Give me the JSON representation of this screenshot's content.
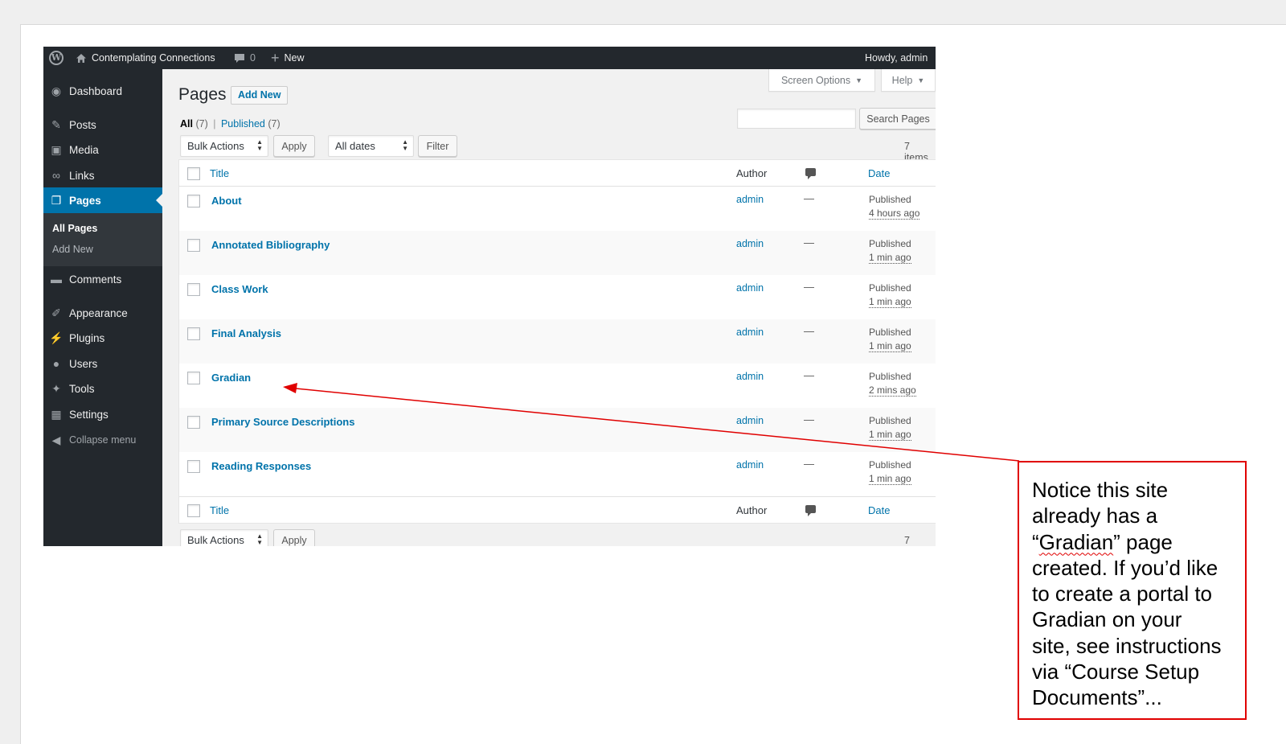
{
  "admin_bar": {
    "site_name": "Contemplating Connections",
    "comments_count": "0",
    "new_label": "New",
    "howdy": "Howdy, admin"
  },
  "sidebar": {
    "items": [
      {
        "label": "Dashboard",
        "icon": "dashboard-icon"
      },
      {
        "label": "Posts",
        "icon": "pin-icon"
      },
      {
        "label": "Media",
        "icon": "media-icon"
      },
      {
        "label": "Links",
        "icon": "link-icon"
      },
      {
        "label": "Pages",
        "icon": "pages-icon"
      },
      {
        "label": "Comments",
        "icon": "comment-icon"
      },
      {
        "label": "Appearance",
        "icon": "brush-icon"
      },
      {
        "label": "Plugins",
        "icon": "plug-icon"
      },
      {
        "label": "Users",
        "icon": "user-icon"
      },
      {
        "label": "Tools",
        "icon": "wrench-icon"
      },
      {
        "label": "Settings",
        "icon": "settings-icon"
      },
      {
        "label": "Collapse menu",
        "icon": "collapse-icon"
      }
    ],
    "submenu": [
      "All Pages",
      "Add New"
    ]
  },
  "header": {
    "title": "Pages",
    "add_new": "Add New",
    "screen_options": "Screen Options",
    "help": "Help"
  },
  "filters": {
    "all_label": "All",
    "all_count": "(7)",
    "separator": "|",
    "published_label": "Published",
    "published_count": "(7)",
    "search_button": "Search Pages",
    "bulk_actions": "Bulk Actions",
    "apply": "Apply",
    "all_dates": "All dates",
    "filter": "Filter",
    "items_count": "7 items"
  },
  "table": {
    "headers": {
      "title": "Title",
      "author": "Author",
      "date": "Date"
    },
    "rows": [
      {
        "title": "About",
        "author": "admin",
        "comments": "—",
        "status": "Published",
        "when": "4 hours ago"
      },
      {
        "title": "Annotated Bibliography",
        "author": "admin",
        "comments": "—",
        "status": "Published",
        "when": "1 min ago"
      },
      {
        "title": "Class Work",
        "author": "admin",
        "comments": "—",
        "status": "Published",
        "when": "1 min ago"
      },
      {
        "title": "Final Analysis",
        "author": "admin",
        "comments": "—",
        "status": "Published",
        "when": "1 min ago"
      },
      {
        "title": "Gradian",
        "author": "admin",
        "comments": "—",
        "status": "Published",
        "when": "2 mins ago"
      },
      {
        "title": "Primary Source Descriptions",
        "author": "admin",
        "comments": "—",
        "status": "Published",
        "when": "1 min ago"
      },
      {
        "title": "Reading Responses",
        "author": "admin",
        "comments": "—",
        "status": "Published",
        "when": "1 min ago"
      }
    ]
  },
  "annotation": {
    "line1": "Notice this site",
    "line2": "already has a",
    "line3_open": "“",
    "line3_word": "Gradian",
    "line3_close": "” page",
    "line4": "created. If you’d like",
    "line5": "to create a portal to",
    "line6": "Gradian on your",
    "line7": "site, see instructions",
    "line8": "via “Course Setup",
    "line9": "Documents”...",
    "color": "#e00000"
  },
  "colors": {
    "wp_blue": "#0073aa",
    "admin_dark": "#23282d"
  }
}
